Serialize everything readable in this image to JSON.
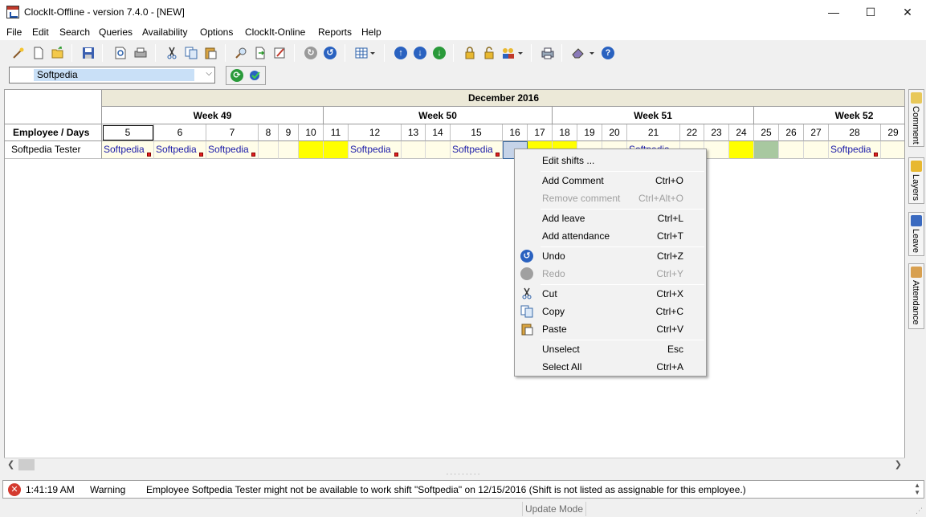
{
  "window": {
    "title": "ClockIt-Offline - version  7.4.0 - [NEW]",
    "controls": {
      "minimize": "—",
      "maximize": "☐",
      "close": "✕"
    }
  },
  "menu": {
    "items": [
      {
        "label": "File"
      },
      {
        "label": "Edit"
      },
      {
        "label": "Search"
      },
      {
        "label": "Queries"
      },
      {
        "label": "Availability"
      },
      {
        "label": "Options"
      },
      {
        "label": "ClockIt-Online"
      },
      {
        "label": "Reports"
      },
      {
        "label": "Help"
      }
    ]
  },
  "toolbar": {
    "icons": [
      "wand-icon",
      "new-document-icon",
      "open-folder-icon",
      "save-icon",
      "print-preview-icon",
      "print-icon",
      "cut-icon",
      "copy-icon",
      "paste-icon",
      "find-icon",
      "export-icon",
      "edit-icon",
      "redo-icon",
      "undo-icon",
      "grid-view-icon",
      "arrow-up-icon",
      "arrow-down-icon",
      "arrow-down-green-icon",
      "lock-icon",
      "unlock-icon",
      "users-icon",
      "printer-icon",
      "eraser-icon",
      "help-icon"
    ]
  },
  "toolbar2": {
    "combo_value": "Softpedia",
    "combo_arrow": "⌵",
    "refresh_icon": "⟳"
  },
  "grid": {
    "month": "December 2016",
    "weeks": [
      "Week 49",
      "Week 50",
      "Week 51",
      "Week 52"
    ],
    "employee_header": "Employee / Days",
    "days": [
      "5",
      "6",
      "7",
      "8",
      "9",
      "10",
      "11",
      "12",
      "13",
      "14",
      "15",
      "16",
      "17",
      "18",
      "19",
      "20",
      "21",
      "22",
      "23",
      "24",
      "25",
      "26",
      "27",
      "28",
      "29"
    ],
    "employee": "Softpedia Tester",
    "shifts": [
      "Softpedia",
      "Softpedia",
      "Softpedia",
      "",
      "",
      "",
      "",
      "Softpedia",
      "",
      "",
      "Softpedia",
      "",
      "",
      "",
      "",
      "",
      "Softpedia",
      "",
      "",
      "",
      "",
      "",
      "",
      "Softpedia",
      ""
    ]
  },
  "side_tabs": [
    "Comment",
    "Layers",
    "Leave",
    "Attendance"
  ],
  "context_menu": {
    "items": [
      {
        "label": "Edit shifts ...",
        "shortcut": ""
      },
      {
        "label": "Add Comment",
        "shortcut": "Ctrl+O"
      },
      {
        "label": "Remove comment",
        "shortcut": "Ctrl+Alt+O",
        "disabled": true
      },
      {
        "label": "Add leave",
        "shortcut": "Ctrl+L"
      },
      {
        "label": "Add attendance",
        "shortcut": "Ctrl+T"
      },
      {
        "label": "Undo",
        "shortcut": "Ctrl+Z"
      },
      {
        "label": "Redo",
        "shortcut": "Ctrl+Y",
        "disabled": true
      },
      {
        "label": "Cut",
        "shortcut": "Ctrl+X"
      },
      {
        "label": "Copy",
        "shortcut": "Ctrl+C"
      },
      {
        "label": "Paste",
        "shortcut": "Ctrl+V"
      },
      {
        "label": "Unselect",
        "shortcut": "Esc"
      },
      {
        "label": "Select All",
        "shortcut": "Ctrl+A"
      }
    ]
  },
  "log": {
    "icon": "✕",
    "time": "1:41:19 AM",
    "level": "Warning",
    "message": "Employee Softpedia Tester might not be available to work shift \"Softpedia\" on 12/15/2016 (Shift is not listed as assignable for this employee.)"
  },
  "status": {
    "mode": "Update Mode"
  },
  "colors": {
    "yellow": "#ffff00",
    "green": "#a8c8a0",
    "shift_text": "#1a1aa8"
  }
}
